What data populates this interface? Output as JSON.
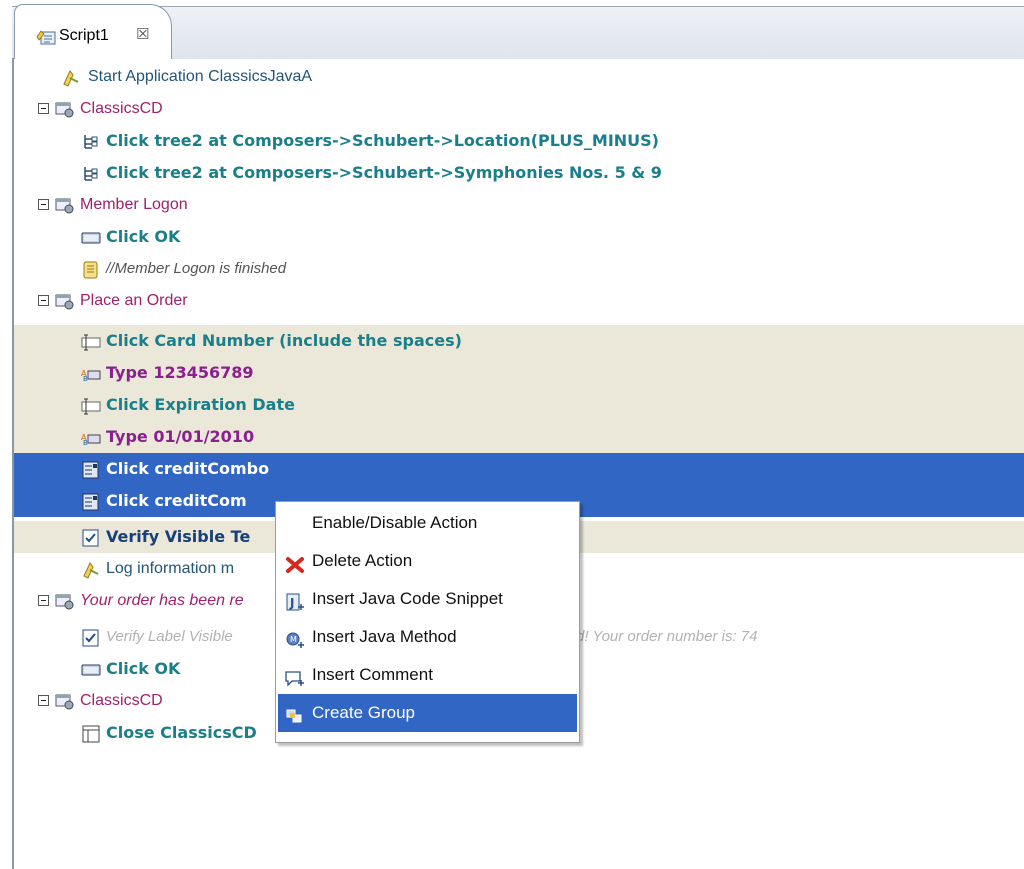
{
  "editor": {
    "tab_label": "Script1",
    "tab_close": "☒"
  },
  "tree": {
    "rows": [
      {
        "text": "Start Application  ClassicsJavaA"
      },
      {
        "text": "ClassicsCD"
      },
      {
        "text": "Click  tree2  at  Composers->Schubert->Location(PLUS_MINUS)"
      },
      {
        "text": "Click  tree2  at  Composers->Schubert->Symphonies Nos. 5 & 9"
      },
      {
        "text": "Member Logon"
      },
      {
        "text": "Click  OK"
      },
      {
        "text": "//Member Logon is finished"
      },
      {
        "text": "Place an Order"
      },
      {
        "text": "Click  Card Number (include the spaces)"
      },
      {
        "text": "Type  123456789"
      },
      {
        "text": "Click  Expiration Date"
      },
      {
        "text": "Type  01/01/2010"
      },
      {
        "text": "Click  creditCombo"
      },
      {
        "text": "Click  creditCom"
      },
      {
        "text": "Verify  Visible Te"
      },
      {
        "text": "Log information  m"
      },
      {
        "text": "Your order has been re"
      },
      {
        "text": "Verify  Label Visible",
        "suffix": "d!  Your order number is: 74"
      },
      {
        "text": "Click  OK"
      },
      {
        "text": "ClassicsCD"
      },
      {
        "text": "Close  ClassicsCD"
      }
    ]
  },
  "context_menu": {
    "items": [
      {
        "label": "Enable/Disable Action"
      },
      {
        "label": "Delete Action"
      },
      {
        "label": "Insert Java Code Snippet"
      },
      {
        "label": "Insert Java Method"
      },
      {
        "label": "Insert Comment"
      },
      {
        "label": "Create Group"
      }
    ]
  }
}
